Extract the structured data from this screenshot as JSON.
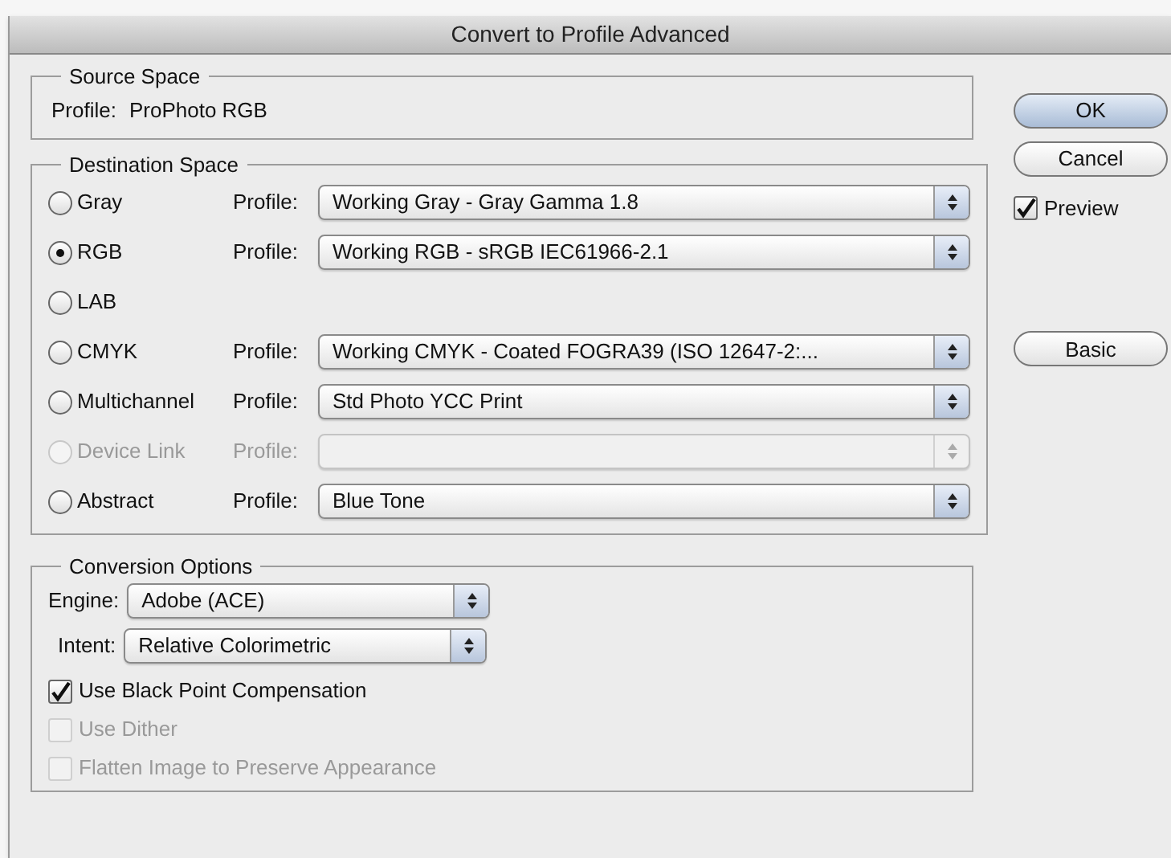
{
  "window": {
    "title": "Convert to Profile Advanced"
  },
  "source_space": {
    "title": "Source Space",
    "label": "Profile:",
    "value": "ProPhoto RGB"
  },
  "destination_space": {
    "title": "Destination Space",
    "options": [
      {
        "label": "Gray",
        "selected": false,
        "disabled": false,
        "profile_label": "Profile:",
        "profile": "Working Gray - Gray Gamma 1.8"
      },
      {
        "label": "RGB",
        "selected": true,
        "disabled": false,
        "profile_label": "Profile:",
        "profile": "Working RGB - sRGB IEC61966-2.1"
      },
      {
        "label": "LAB",
        "selected": false,
        "disabled": false
      },
      {
        "label": "CMYK",
        "selected": false,
        "disabled": false,
        "profile_label": "Profile:",
        "profile": "Working CMYK - Coated FOGRA39 (ISO 12647-2:..."
      },
      {
        "label": "Multichannel",
        "selected": false,
        "disabled": false,
        "profile_label": "Profile:",
        "profile": "Std Photo YCC Print"
      },
      {
        "label": "Device Link",
        "selected": false,
        "disabled": true,
        "profile_label": "Profile:"
      },
      {
        "label": "Abstract",
        "selected": false,
        "disabled": false,
        "profile_label": "Profile:",
        "profile": "Blue Tone"
      }
    ]
  },
  "conversion_options": {
    "title": "Conversion Options",
    "engine_label": "Engine:",
    "engine": "Adobe (ACE)",
    "intent_label": "Intent:",
    "intent": "Relative Colorimetric",
    "checkboxes": [
      {
        "label": "Use Black Point Compensation",
        "checked": true,
        "disabled": false
      },
      {
        "label": "Use Dither",
        "checked": false,
        "disabled": true
      },
      {
        "label": "Flatten Image to Preserve Appearance",
        "checked": false,
        "disabled": true
      }
    ]
  },
  "buttons": [
    {
      "label": "OK",
      "default": true
    },
    {
      "label": "Cancel",
      "default": false
    }
  ],
  "preview": {
    "label": "Preview",
    "checked": true
  },
  "basic_button": {
    "label": "Basic"
  }
}
